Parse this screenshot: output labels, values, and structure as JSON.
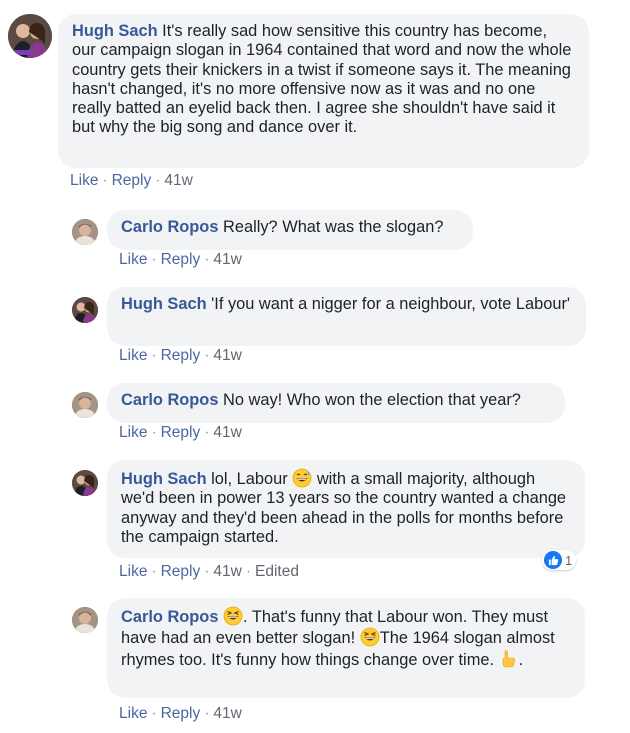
{
  "comments": [
    {
      "author": "Hugh Sach",
      "text": " It's really sad how sensitive this country has become, our campaign slogan in 1964 contained that word and now the whole country gets their knickers in a twist if someone says it. The meaning hasn't changed, it's no more offensive now as it was and no one really batted an eyelid back then. I agree she shouldn't have said it but why the big song and dance over it.",
      "like": "Like",
      "reply": "Reply",
      "time": "41w",
      "avatar_icon": "profile-photo-couple"
    },
    {
      "author": "Carlo Ropos",
      "text": " Really? What was the slogan?",
      "like": "Like",
      "reply": "Reply",
      "time": "41w",
      "avatar_icon": "profile-photo-man"
    },
    {
      "author": "Hugh Sach",
      "text": " 'If you want a nigger for a neighbour, vote Labour'",
      "like": "Like",
      "reply": "Reply",
      "time": "41w",
      "avatar_icon": "profile-photo-couple"
    },
    {
      "author": "Carlo Ropos",
      "text": " No way! Who won the election that year?",
      "like": "Like",
      "reply": "Reply",
      "time": "41w",
      "avatar_icon": "profile-photo-man"
    },
    {
      "author": "Hugh Sach",
      "text_a": " lol, Labour ",
      "text_b": " with a small majority, although we'd been in power 13 years so the country wanted a change anyway and they'd been ahead in the polls for months before the campaign started.",
      "like": "Like",
      "reply": "Reply",
      "time": "41w",
      "edited": "Edited",
      "reaction_count": "1",
      "reaction_icon": "like-thumb-icon",
      "emoji_icon": "grinning-sweat-emoji",
      "avatar_icon": "profile-photo-couple"
    },
    {
      "author": "Carlo Ropos",
      "text_a": ". That's funny that Labour won. They must have had an even better slogan! ",
      "text_b": "The 1964 slogan almost rhymes too. It's funny how things change over time. ",
      "text_c": ".",
      "like": "Like",
      "reply": "Reply",
      "time": "41w",
      "emoji_icon": "grinning-squinting-emoji",
      "pointing_icon": "pointing-hand-emoji",
      "avatar_icon": "profile-photo-man"
    }
  ],
  "dot": "·",
  "colors": {
    "name": "#385898",
    "link": "#4b67a1",
    "bubble": "#f2f3f5",
    "like_blue": "#1877f2"
  }
}
